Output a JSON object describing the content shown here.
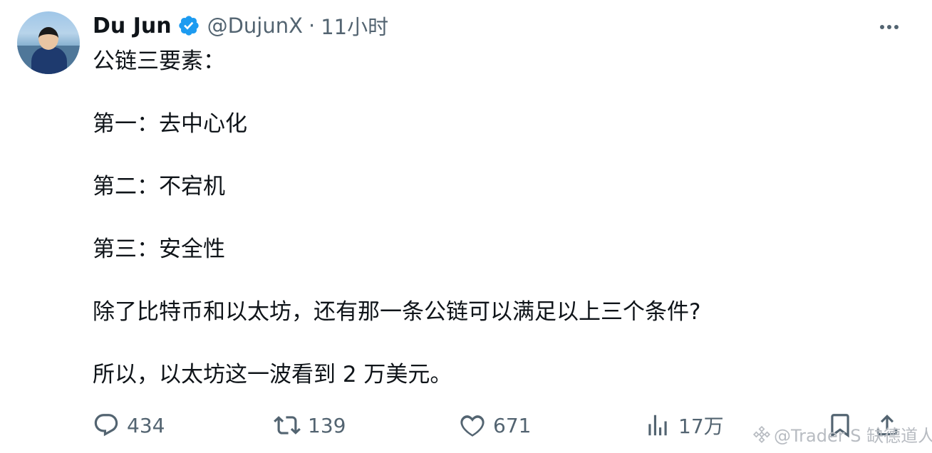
{
  "tweet": {
    "author": {
      "display_name": "Du Jun",
      "handle": "@DujunX",
      "verified": true
    },
    "time_sep": "·",
    "time": "11小时",
    "text": "公链三要素：\n\n第一：去中心化\n\n第二：不宕机\n\n第三：安全性\n\n除了比特币和以太坊，还有那一条公链可以满足以上三个条件?\n\n所以，以太坊这一波看到 2 万美元。"
  },
  "actions": {
    "reply": {
      "icon": "reply-icon",
      "count": "434"
    },
    "retweet": {
      "icon": "retweet-icon",
      "count": "139"
    },
    "like": {
      "icon": "heart-icon",
      "count": "671"
    },
    "views": {
      "icon": "views-icon",
      "count": "17万"
    },
    "bookmark": {
      "icon": "bookmark-icon"
    },
    "share": {
      "icon": "share-icon"
    }
  },
  "watermark": {
    "icon": "binance-icon",
    "text": "@Trader S 缺德道人"
  },
  "colors": {
    "text": "#0f1419",
    "muted": "#536471",
    "verified": "#1d9bf0"
  }
}
